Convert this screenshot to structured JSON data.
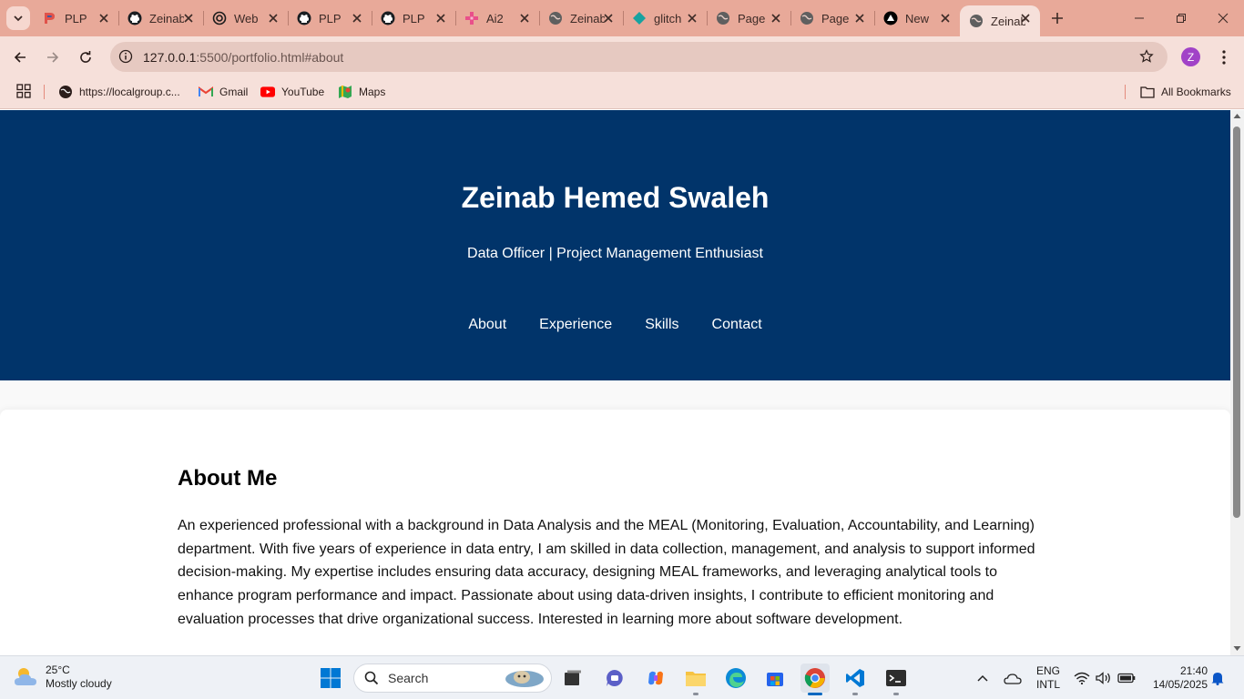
{
  "browser": {
    "tabs": [
      {
        "label": "PLP",
        "icon": "plp-icon"
      },
      {
        "label": "Zeinab",
        "icon": "github-icon"
      },
      {
        "label": "Web",
        "icon": "openai-icon"
      },
      {
        "label": "PLP",
        "icon": "github-icon"
      },
      {
        "label": "PLP",
        "icon": "github-icon"
      },
      {
        "label": "Ai2",
        "icon": "ai2-icon"
      },
      {
        "label": "Zeinab",
        "icon": "globe-icon"
      },
      {
        "label": "glitch",
        "icon": "glitch-icon"
      },
      {
        "label": "Page",
        "icon": "globe-icon"
      },
      {
        "label": "Page",
        "icon": "globe-icon"
      },
      {
        "label": "New",
        "icon": "vercel-icon"
      },
      {
        "label": "Zeinab",
        "icon": "globe-icon",
        "active": true
      }
    ],
    "url": {
      "host": "127.0.0.1",
      "path": ":5500/portfolio.html#about"
    },
    "profile_initial": "Z",
    "bookmarks": [
      {
        "label": "https://localgroup.c...",
        "icon": "globe-icon"
      },
      {
        "label": "Gmail",
        "icon": "gmail-icon"
      },
      {
        "label": "YouTube",
        "icon": "youtube-icon"
      },
      {
        "label": "Maps",
        "icon": "maps-icon"
      }
    ],
    "all_bookmarks_label": "All Bookmarks"
  },
  "page": {
    "name": "Zeinab Hemed Swaleh",
    "subtitle": "Data Officer | Project Management Enthusiast",
    "nav": [
      "About",
      "Experience",
      "Skills",
      "Contact"
    ],
    "about": {
      "heading": "About Me",
      "body": "An experienced professional with a background in Data Analysis and the MEAL (Monitoring, Evaluation, Accountability, and Learning) department. With five years of experience in data entry, I am skilled in data collection, management, and analysis to support informed decision-making. My expertise includes ensuring data accuracy, designing MEAL frameworks, and leveraging analytical tools to enhance program performance and impact. Passionate about using data-driven insights, I contribute to efficient monitoring and evaluation processes that drive organizational success. Interested in learning more about software development."
    },
    "colors": {
      "hero_bg": "#01346a",
      "tab_strip": "#e8a999",
      "toolbar": "#f6e0da"
    }
  },
  "taskbar": {
    "weather": {
      "temp": "25°C",
      "condition": "Mostly cloudy"
    },
    "search_placeholder": "Search",
    "language": {
      "line1": "ENG",
      "line2": "INTL"
    },
    "time": "21:40",
    "date": "14/05/2025"
  }
}
